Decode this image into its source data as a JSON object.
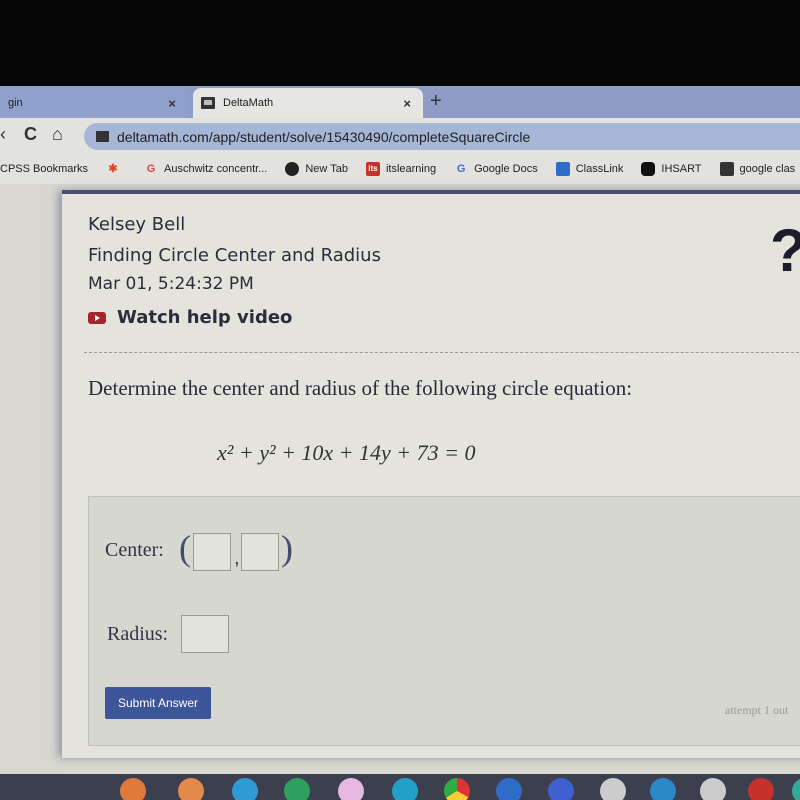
{
  "browser": {
    "tabs": [
      {
        "title": "gin",
        "active": false
      },
      {
        "title": "DeltaMath",
        "active": true
      }
    ],
    "close_glyph": "×",
    "new_tab_glyph": "+",
    "url": "deltamath.com/app/student/solve/15430490/completeSquareCircle",
    "nav": {
      "back": "‹",
      "reload": "C",
      "home": "⌂"
    },
    "bookmarks": [
      {
        "label": "CPSS Bookmarks",
        "icon": "folder-icon"
      },
      {
        "label": "",
        "icon": "pinwheel-icon"
      },
      {
        "label": "Auschwitz concentr...",
        "icon": "google-icon"
      },
      {
        "label": "New Tab",
        "icon": "globe-icon"
      },
      {
        "label": "itslearning",
        "icon": "itslearning-icon"
      },
      {
        "label": "Google Docs",
        "icon": "google-icon"
      },
      {
        "label": "ClassLink",
        "icon": "classlink-icon"
      },
      {
        "label": "IHSART",
        "icon": "hexagon-icon"
      },
      {
        "label": "google clas",
        "icon": "classroom-icon"
      }
    ]
  },
  "header": {
    "student": "Kelsey Bell",
    "assignment": "Finding Circle Center and Radius",
    "timestamp": "Mar 01, 5:24:32 PM",
    "help_link": "Watch help video",
    "help_glyph": "?"
  },
  "problem": {
    "prompt": "Determine the center and radius of the following circle equation:",
    "equation": "x² + y² + 10x + 14y + 73 = 0"
  },
  "answer": {
    "center_label": "Center:",
    "radius_label": "Radius:",
    "open_paren": "(",
    "close_paren": ")",
    "comma": ",",
    "center_x": "",
    "center_y": "",
    "radius": "",
    "submit_label": "Submit Answer",
    "attempt_text": "attempt 1 out"
  },
  "shelf": {
    "apps": [
      "itslearning",
      "share",
      "app-3",
      "app-4",
      "app-5",
      "app-6",
      "chrome",
      "app-8",
      "app-9",
      "app-10",
      "app-11",
      "app-12",
      "app-13",
      "app-14"
    ]
  }
}
